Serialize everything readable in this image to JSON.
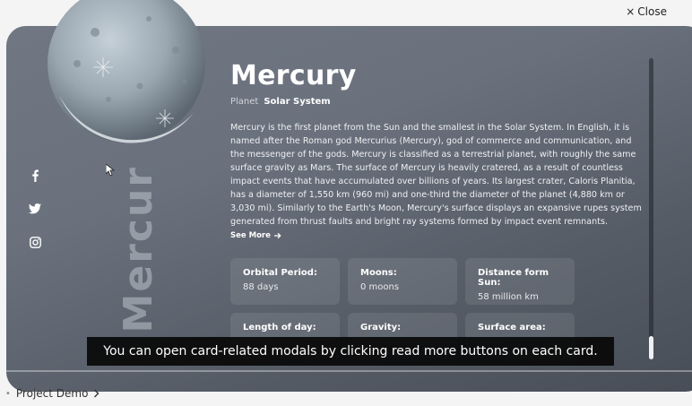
{
  "window": {
    "close_label": "Close",
    "close_icon": "×"
  },
  "planet": {
    "name": "Mercury",
    "vertical_name": "Mercur",
    "type_label": "Planet",
    "system": "Solar System",
    "description": "Mercury is the first planet from the Sun and the smallest in the Solar System. In English, it is named after the Roman god Mercurius (Mercury), god of commerce and communication, and the messenger of the gods. Mercury is classified as a terrestrial planet, with roughly the same surface gravity as Mars. The surface of Mercury is heavily cratered, as a result of countless impact events that have accumulated over billions of years. Its largest crater, Caloris Planitia, has a diameter of 1,550 km (960 mi) and one-third the diameter of the planet (4,880 km or 3,030 mi). Similarly to the Earth's Moon, Mercury's surface displays an expansive rupes system generated from thrust faults and bright ray systems formed by impact event remnants.",
    "see_more_label": "See More",
    "colors": {
      "modal_bg": "#6a717d",
      "planet": "#9aa7b1"
    }
  },
  "stats": [
    {
      "label": "Orbital Period:",
      "value": "88 days"
    },
    {
      "label": "Moons:",
      "value": "0 moons"
    },
    {
      "label": "Distance form Sun:",
      "value": "58 million km"
    },
    {
      "label": "Length of day:",
      "value": ""
    },
    {
      "label": "Gravity:",
      "value": ""
    },
    {
      "label": "Surface area:",
      "value": ""
    }
  ],
  "social": {
    "facebook_icon": "facebook-icon",
    "twitter_icon": "twitter-icon",
    "instagram_icon": "instagram-icon"
  },
  "caption": "You can open card-related modals by clicking read more buttons on each card.",
  "footer": {
    "project_demo_label": "Project Demo"
  }
}
